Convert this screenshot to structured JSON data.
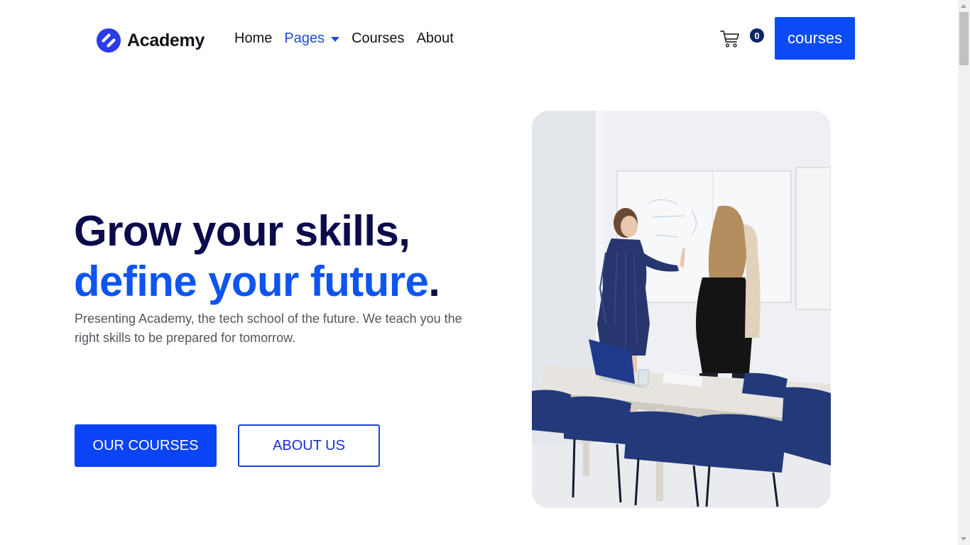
{
  "brand": {
    "name": "Academy",
    "color": "#2b3bea"
  },
  "nav": {
    "items": [
      {
        "label": "Home",
        "active": false
      },
      {
        "label": "Pages",
        "active": true,
        "dropdown": true
      },
      {
        "label": "Courses",
        "active": false
      },
      {
        "label": "About",
        "active": false
      }
    ]
  },
  "cart": {
    "icon": "cart-icon",
    "count": "0"
  },
  "header_cta": {
    "label": "courses"
  },
  "hero": {
    "title_line1": "Grow your skills,",
    "title_line2": "define your future",
    "title_dot": ".",
    "description": "Presenting Academy, the tech school of the future. We teach you the right skills to be prepared for tomorrow.",
    "primary_button": "OUR COURSES",
    "secondary_button": "ABOUT US",
    "image": "team-meeting-whiteboard-photo"
  },
  "colors": {
    "primary": "#0a44f5",
    "heading": "#0b0a4a",
    "accent": "#0e55f0",
    "badge": "#0b2569",
    "text": "#52575e"
  }
}
